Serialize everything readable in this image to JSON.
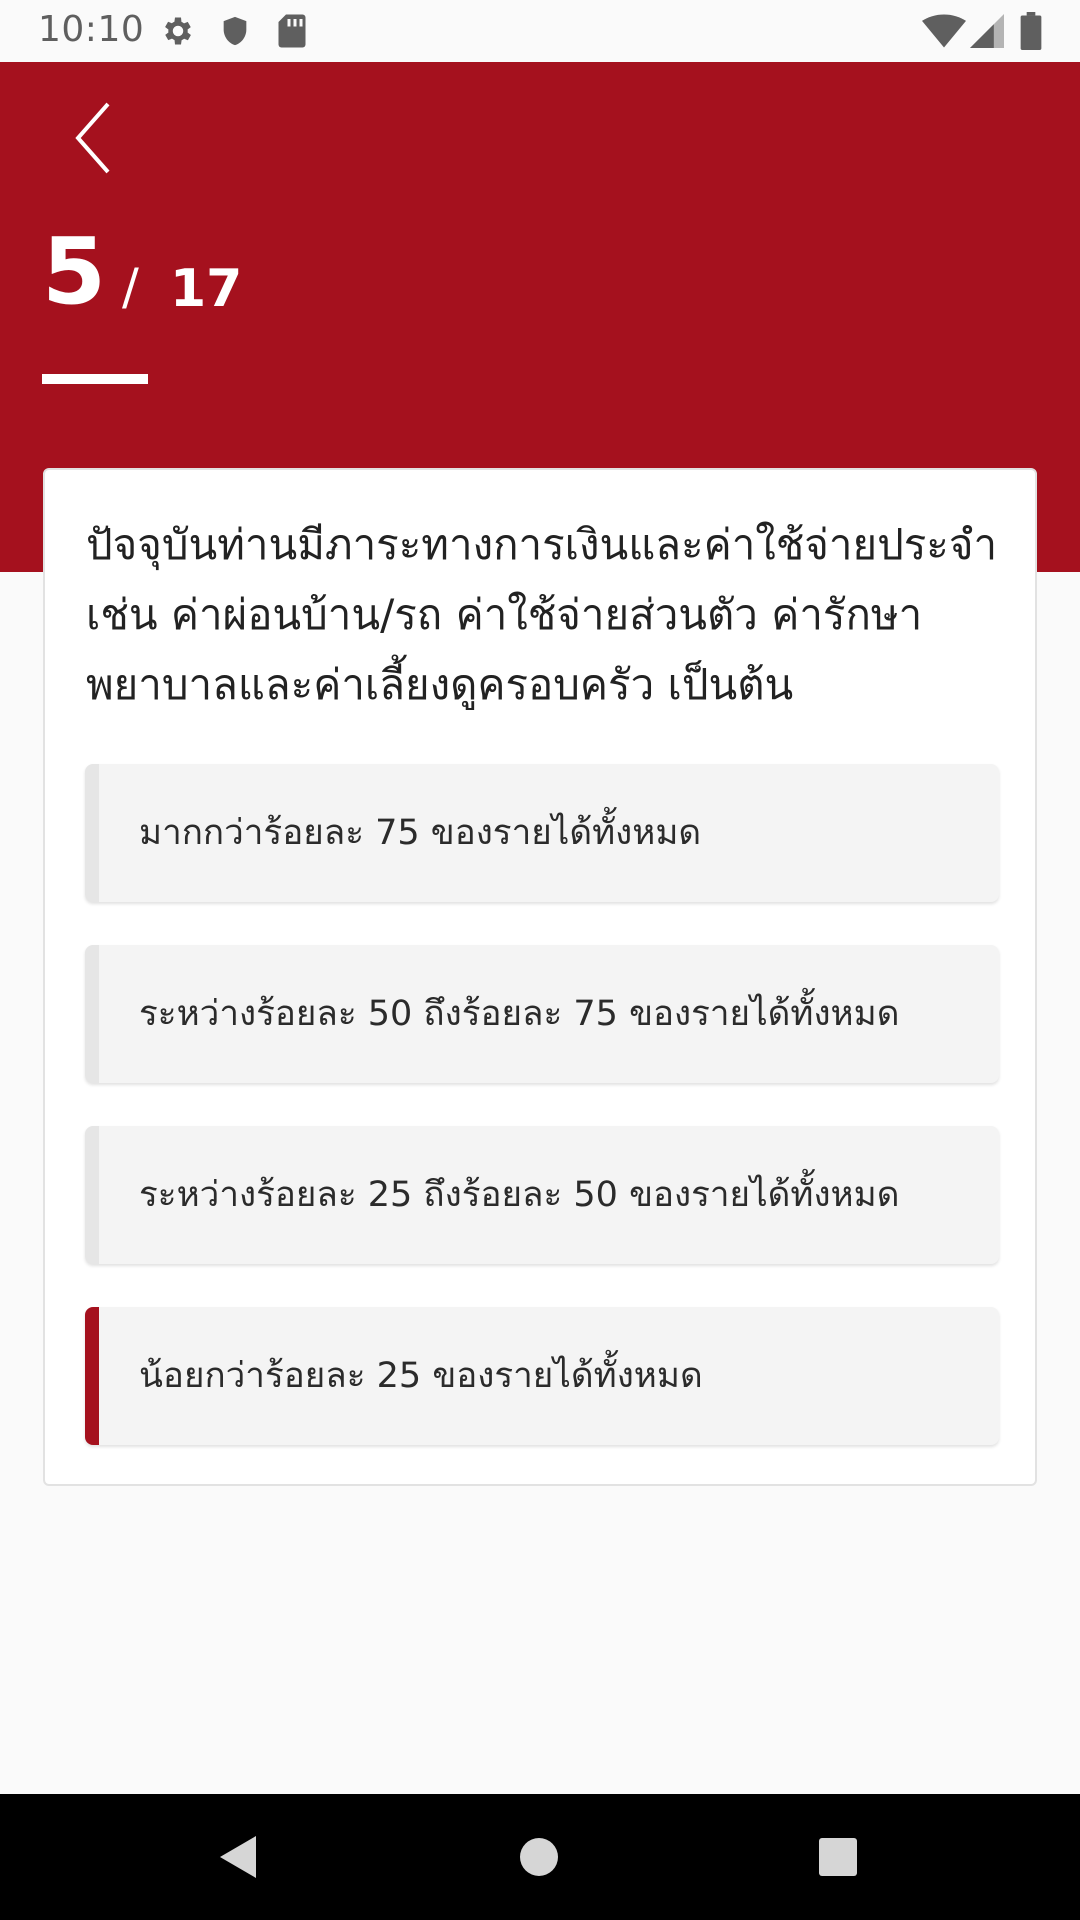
{
  "status_bar": {
    "time": "10:10",
    "icons": [
      "gear-icon",
      "shield-icon",
      "sd-card-icon",
      "wifi-icon",
      "signal-icon",
      "battery-icon"
    ]
  },
  "header": {
    "back_icon": "chevron-left-icon",
    "progress": {
      "current": "5",
      "separator": "/",
      "total": "17"
    },
    "accent_color": "#a5111e"
  },
  "question": {
    "text": "ปัจจุบันท่านมีภาระทางการเงินและค่าใช้จ่ายประจำ เช่น ค่าผ่อนบ้าน/รถ ค่าใช้จ่ายส่วนตัว ค่ารักษาพยาบาลและค่าเลี้ยงดูครอบครัว เป็นต้น",
    "options": [
      {
        "label": "มากกว่าร้อยละ 75 ของรายได้ทั้งหมด",
        "selected": false
      },
      {
        "label": "ระหว่างร้อยละ 50 ถึงร้อยละ 75 ของรายได้ทั้งหมด",
        "selected": false
      },
      {
        "label": "ระหว่างร้อยละ 25 ถึงร้อยละ 50 ของรายได้ทั้งหมด",
        "selected": false
      },
      {
        "label": "น้อยกว่าร้อยละ 25 ของรายได้ทั้งหมด",
        "selected": true
      }
    ]
  },
  "nav_bar": {
    "icons": [
      "back-triangle-icon",
      "home-circle-icon",
      "recents-square-icon"
    ]
  }
}
